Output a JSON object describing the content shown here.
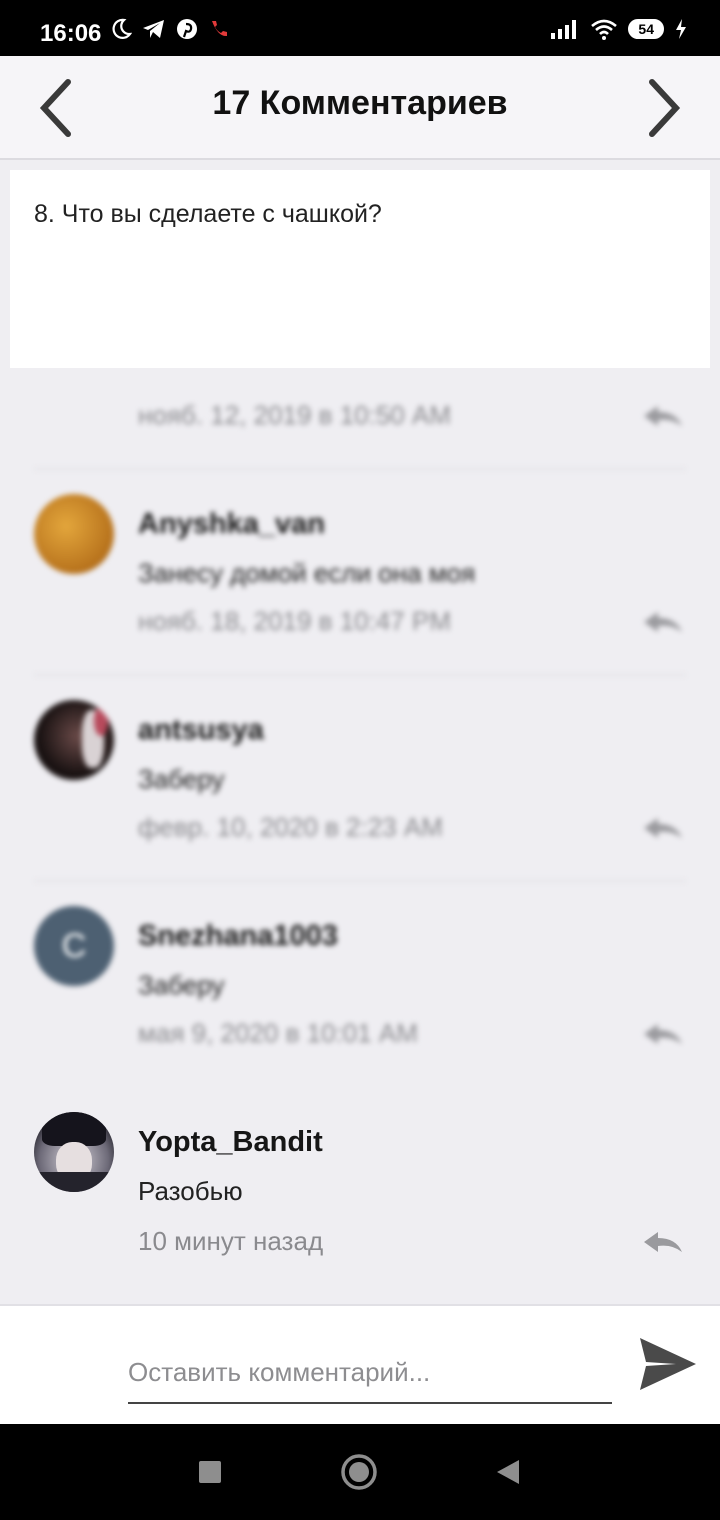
{
  "status_bar": {
    "time": "16:06",
    "battery": "54"
  },
  "header": {
    "title": "17 Комментариев"
  },
  "question": {
    "text": "8. Что вы сделаете с чашкой?"
  },
  "comments": [
    {
      "name": "",
      "text": "",
      "date": "нояб. 12, 2019 в 10:50 AM"
    },
    {
      "name": "Anyshka_van",
      "text": "Занесу домой если она моя",
      "date": "нояб. 18, 2019 в 10:47 PM"
    },
    {
      "name": "antsusya",
      "text": "Заберу",
      "date": "февр. 10, 2020 в 2:23 AM"
    },
    {
      "name": "Snezhana1003",
      "avatar_letter": "C",
      "text": "Заберу",
      "date": "мая 9, 2020 в 10:01 AM"
    },
    {
      "name": "Yopta_Bandit",
      "text": "Разобью",
      "date": "10 минут назад"
    }
  ],
  "input": {
    "placeholder": "Оставить комментарий..."
  },
  "colors": {
    "background": "#efeef2",
    "header_bg": "#f6f5f8",
    "avatar_snezhana": "#4d6072",
    "avatar_anyshka": "#c9872a"
  },
  "icons": {
    "prev": "chevron-left-icon",
    "next": "chevron-right-icon",
    "reply": "reply-icon",
    "send": "send-icon"
  }
}
